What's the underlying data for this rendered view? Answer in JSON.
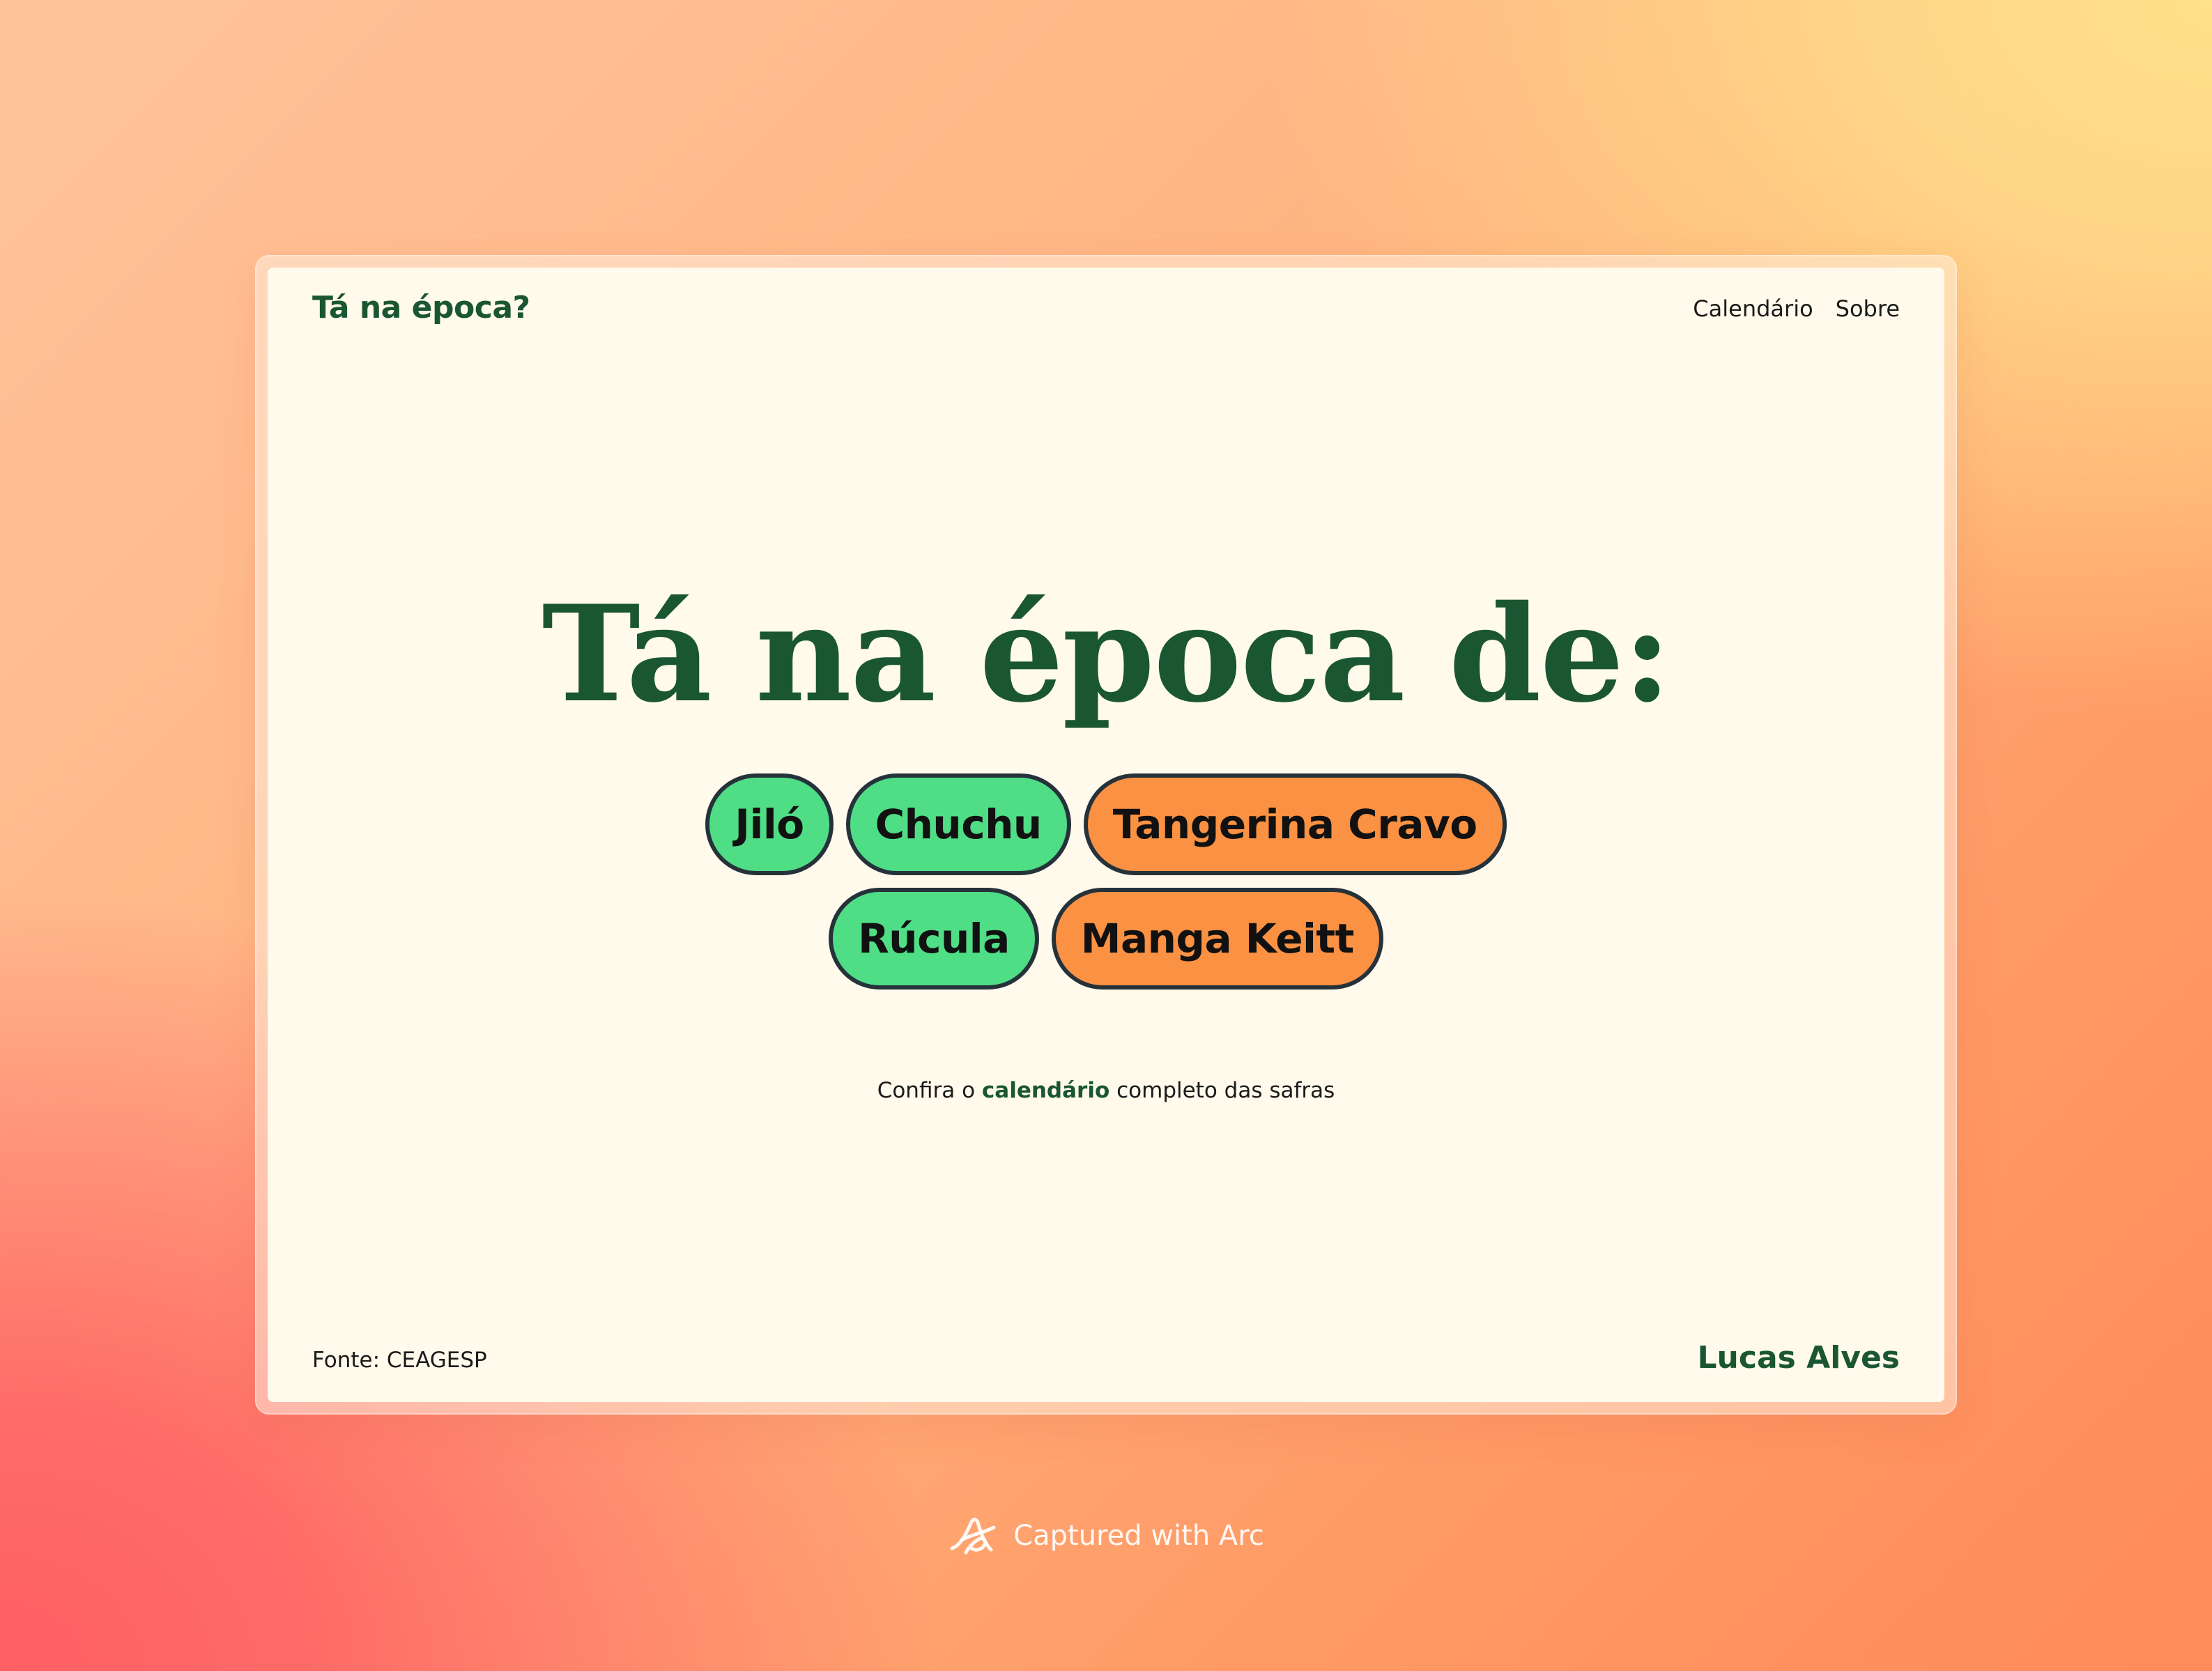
{
  "header": {
    "brand": "Tá na época?",
    "nav": [
      {
        "label": "Calendário"
      },
      {
        "label": "Sobre"
      }
    ]
  },
  "hero": {
    "title": "Tá na época de:"
  },
  "chips": [
    {
      "label": "Jiló",
      "type": "green"
    },
    {
      "label": "Chuchu",
      "type": "green"
    },
    {
      "label": "Tangerina Cravo",
      "type": "orange"
    },
    {
      "label": "Rúcula",
      "type": "green"
    },
    {
      "label": "Manga Keitt",
      "type": "orange"
    }
  ],
  "cta": {
    "prefix": "Confira o",
    "link": "calendário",
    "suffix": "completo das safras"
  },
  "footer": {
    "source": "Fonte: CEAGESP",
    "author": "Lucas Alves"
  },
  "badge": {
    "text": "Captured with Arc",
    "icon": "arc-logo-icon"
  },
  "colors": {
    "brand_green": "#1a5632",
    "chip_green": "#4fdd85",
    "chip_orange": "#fb9143",
    "page_bg": "#fffaeb"
  }
}
